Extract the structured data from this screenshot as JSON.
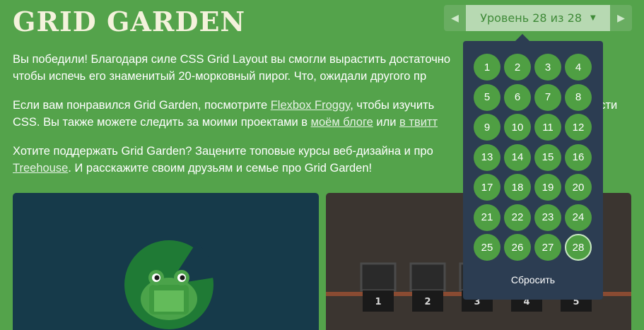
{
  "header": {
    "title": "GRID GARDEN",
    "level_label": "Уровень 28 из 28",
    "prev_icon": "triangle-left",
    "next_icon": "triangle-right",
    "caret_icon": "caret-down"
  },
  "content": {
    "p1_line1": "Вы победили! Благодаря силе CSS Grid Layout вы смогли вырастить достаточно",
    "p1_line2": "чтобы испечь его знаменитый 20-морковный пирог. Что, ожидали другого пр",
    "p2_text1": "Если вам понравился Grid Garden, посмотрите ",
    "p2_link1": "Flexbox Froggy",
    "p2_text2": ", чтобы изучить",
    "p2_text3": "сти",
    "p2_text4": "CSS. Вы также можете следить за моими проектами в ",
    "p2_link2": "моём блоге",
    "p2_text5": " или ",
    "p2_link3": "в твитт",
    "p3_line1": "Хотите поддержать Grid Garden? Зацените топовые курсы веб-дизайна и про",
    "p3_link": "Treehouse",
    "p3_text": ". И расскажите своим друзьям и семье про Grid Garden!"
  },
  "level_menu": {
    "levels": [
      "1",
      "2",
      "3",
      "4",
      "5",
      "6",
      "7",
      "8",
      "9",
      "10",
      "11",
      "12",
      "13",
      "14",
      "15",
      "16",
      "17",
      "18",
      "19",
      "20",
      "21",
      "22",
      "23",
      "24",
      "25",
      "26",
      "27",
      "28"
    ],
    "current": "28",
    "reset_label": "Сбросить"
  },
  "panel_right": {
    "cart_numbers": [
      "1",
      "2",
      "3",
      "4",
      "5"
    ]
  },
  "colors": {
    "background": "#54a34b",
    "dropdown": "#2c3d52",
    "level_button": "#4f9f43",
    "board_left": "#163a4a",
    "board_right": "#3b3530"
  }
}
